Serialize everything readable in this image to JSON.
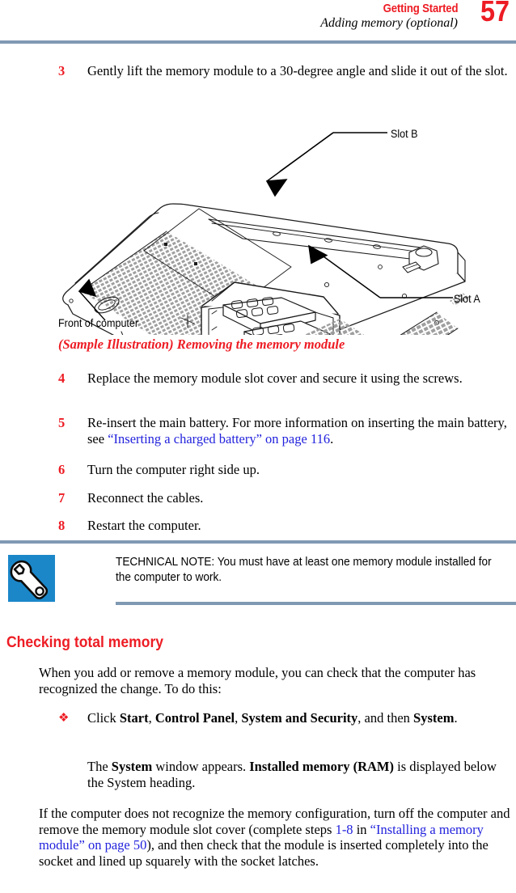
{
  "header": {
    "chapter": "Getting Started",
    "section": "Adding memory (optional)",
    "page_number": "57",
    "accent_color": "#ed1c24",
    "rule_color": "#8099b3"
  },
  "steps_upper": [
    {
      "number": "3",
      "text": "Gently lift the memory module to a 30-degree angle and slide it out of the slot."
    }
  ],
  "figure": {
    "caption_prefix": "(Sample Illustration)",
    "caption": "(Sample Illustration) Removing the memory module",
    "labels": {
      "slot_b": "Slot B",
      "slot_a": "Slot A",
      "front_of_computer": "Front of computer"
    },
    "alt": "Line drawing of the underside of a laptop computer with the memory module slot cover removed, showing two memory modules, with arrows pointing to Slot B and Slot A and an arrow indicating the front of the computer."
  },
  "steps_lower": [
    {
      "number": "4",
      "text": "Replace the memory module slot cover and secure it using the screws."
    },
    {
      "number": "5",
      "text_before": "Re-insert the main battery. For more information on inserting the main battery, see ",
      "link": "“Inserting a charged battery” on page 116",
      "text_after": "."
    },
    {
      "number": "6",
      "text": "Turn the computer right side up."
    },
    {
      "number": "7",
      "text": "Reconnect the cables."
    },
    {
      "number": "8",
      "text": "Restart the computer."
    }
  ],
  "note": {
    "icon": "wrench-icon",
    "icon_bg_color": "#1b87c9",
    "text": "TECHNICAL NOTE: You must have at least one memory module installed for the computer to work."
  },
  "section": {
    "heading": "Checking total memory",
    "intro": "When you add or remove a memory module, you can check that the computer has recognized the change. To do this:",
    "bullet": {
      "glyph": "❖",
      "part1": "Click ",
      "bold1": "Start",
      "part2": ", ",
      "bold2": "Control Panel",
      "part3": ", ",
      "bold3": "System and Security",
      "part4": ", and then ",
      "bold4": "System",
      "part5": "."
    },
    "result": {
      "part1": "The ",
      "bold1": "System",
      "part2": " window appears. ",
      "bold2": "Installed memory (RAM)",
      "part3": " is displayed below the System heading."
    },
    "closing": {
      "part1": "If the computer does not recognize the memory configuration, turn off the computer and remove the memory module slot cover (complete steps ",
      "link1": "1-8",
      "part2": " in ",
      "link2": "“Installing a memory module” on page 50",
      "part3": "), and then check that the module is inserted completely into the socket and lined up squarely with the socket latches."
    }
  }
}
